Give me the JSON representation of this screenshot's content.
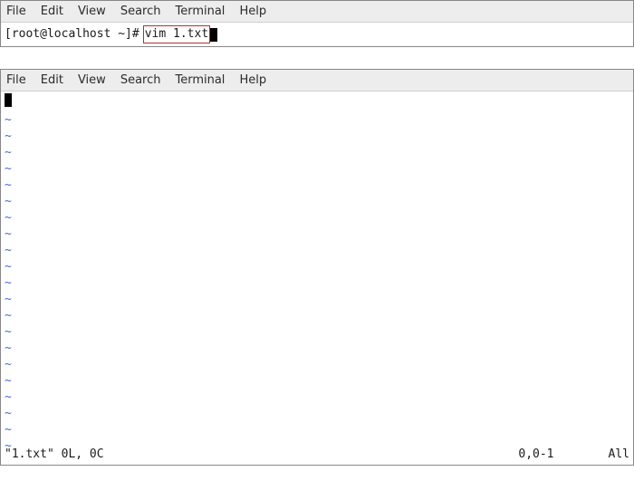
{
  "terminal1": {
    "menu": {
      "file": "File",
      "edit": "Edit",
      "view": "View",
      "search": "Search",
      "terminal": "Terminal",
      "help": "Help"
    },
    "prompt": "[root@localhost ~]#",
    "command": "vim 1.txt"
  },
  "terminal2": {
    "menu": {
      "file": "File",
      "edit": "Edit",
      "view": "View",
      "search": "Search",
      "terminal": "Terminal",
      "help": "Help"
    },
    "tilde": "~",
    "status": {
      "file": "\"1.txt\" 0L, 0C",
      "pos": "0,0-1",
      "view": "All"
    },
    "tilde_count": 21
  }
}
